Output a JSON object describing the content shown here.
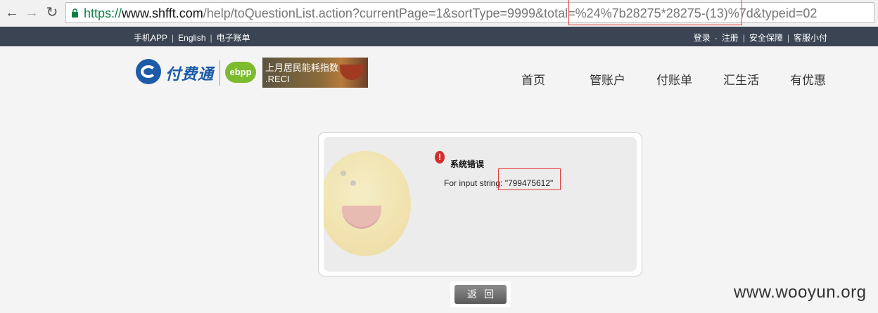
{
  "browser": {
    "url_scheme": "https://",
    "url_host": "www.shfft.com",
    "url_rest": "/help/toQuestionList.action?currentPage=1&sortType=9999&total=%24%7b28275*28275-(13)%7d&typeid=02",
    "back_glyph": "←",
    "forward_glyph": "→",
    "reload_glyph": "↻"
  },
  "topbar": {
    "left_links": [
      "手机APP",
      "English",
      "电子账单"
    ],
    "right_links": [
      "登录",
      "注册",
      "安全保障",
      "客服小付"
    ],
    "login_sep": "-",
    "bar_sep": "|"
  },
  "header": {
    "logo_text": "付费通",
    "ebpp_label": "ebpp",
    "banner_line1": "上月居民能耗指数",
    "banner_line2": ".RECI",
    "nav": [
      "首页",
      "管账户",
      "付账单",
      "汇生活",
      "有优惠"
    ]
  },
  "error": {
    "icon_glyph": "!",
    "title": "系统错误",
    "message": "For input string: \"799475612\""
  },
  "back_button_label": "返回",
  "watermark": "www.wooyun.org",
  "colors": {
    "topbar_bg": "#3a4453",
    "brand_blue": "#1d5aa8",
    "highlight_red": "#e23b3b",
    "ebpp_green": "#7dbb2e"
  }
}
